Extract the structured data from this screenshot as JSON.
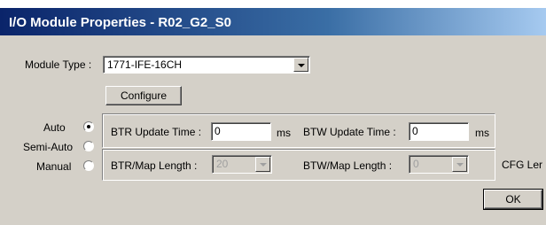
{
  "window": {
    "title": "I/O Module Properties - R02_G2_S0"
  },
  "module_type": {
    "label": "Module Type :",
    "value": "1771-IFE-16CH"
  },
  "configure_button": "Configure",
  "mode_radios": [
    {
      "label": "Auto",
      "selected": true
    },
    {
      "label": "Semi-Auto",
      "selected": false
    },
    {
      "label": "Manual",
      "selected": false
    }
  ],
  "btr_update": {
    "label": "BTR Update Time :",
    "value": "0",
    "unit": "ms"
  },
  "btw_update": {
    "label": "BTW Update Time :",
    "value": "0",
    "unit": "ms"
  },
  "btr_map": {
    "label": "BTR/Map Length :",
    "value": "20"
  },
  "btw_map": {
    "label": "BTW/Map Length :",
    "value": "0"
  },
  "cfg_len_label": "CFG Ler",
  "ok_button": "OK"
}
